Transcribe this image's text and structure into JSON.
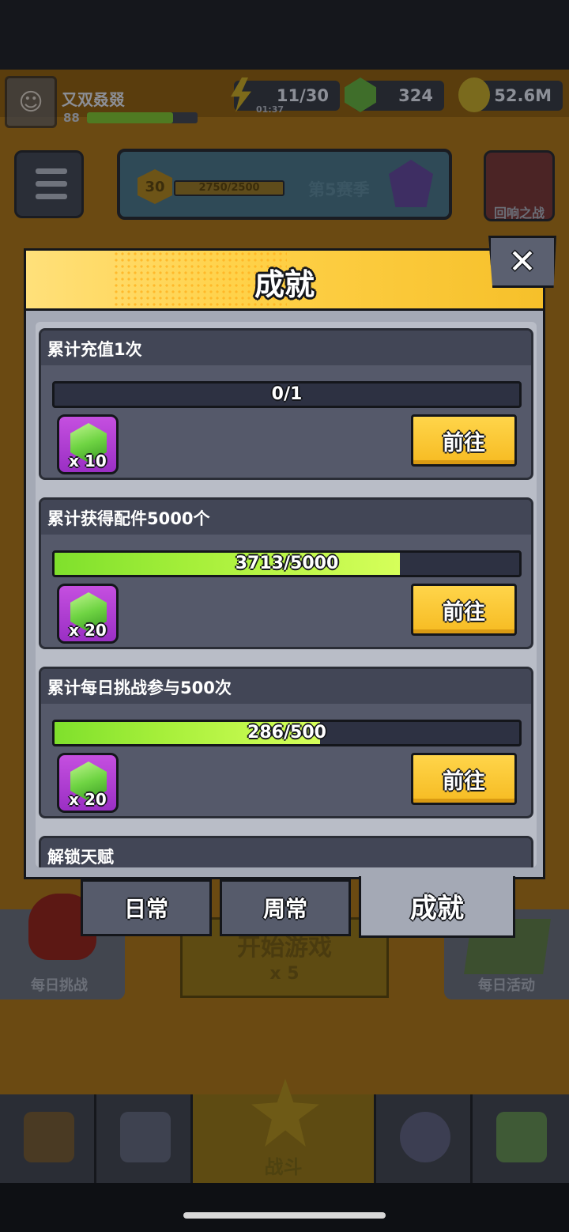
{
  "player": {
    "name": "又双叒叕",
    "level": "88"
  },
  "resources": {
    "energy": {
      "value": "11/30",
      "timer": "01:37"
    },
    "gems": {
      "value": "324"
    },
    "coins": {
      "value": "52.6M"
    }
  },
  "season": {
    "level": "30",
    "progress": "2750/2500",
    "name": "第5赛季"
  },
  "echo_battle": {
    "label": "回响之战"
  },
  "side_left": {
    "label": "每日挑战"
  },
  "side_right": {
    "label": "每日活动"
  },
  "start_game": {
    "label": "开始游戏",
    "cost": "x 5"
  },
  "bottom_nav": {
    "battle_label": "战斗"
  },
  "modal": {
    "title": "成就",
    "close_label": "✕",
    "go_label": "前往",
    "achievements": [
      {
        "title": "累计充值1次",
        "progress_text": "0/1",
        "progress": 0.0,
        "reward_count": "x 10"
      },
      {
        "title": "累计获得配件5000个",
        "progress_text": "3713/5000",
        "progress": 0.7426,
        "reward_count": "x 20"
      },
      {
        "title": "累计每日挑战参与500次",
        "progress_text": "286/500",
        "progress": 0.572,
        "reward_count": "x 20"
      },
      {
        "title": "解锁天赋"
      }
    ],
    "tabs": [
      {
        "label": "日常",
        "active": false
      },
      {
        "label": "周常",
        "active": false
      },
      {
        "label": "成就",
        "active": true
      }
    ]
  }
}
